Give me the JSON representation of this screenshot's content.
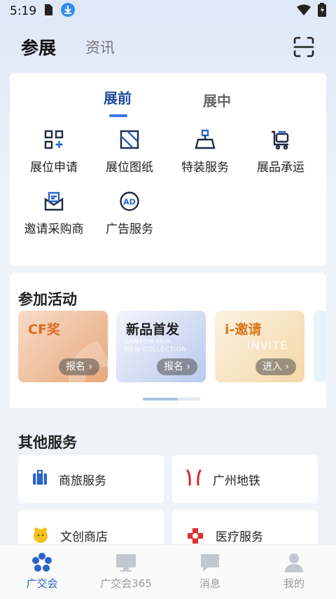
{
  "status_bar": {
    "time": "5:19"
  },
  "header": {
    "tabs": [
      "参展",
      "资讯"
    ]
  },
  "exhibit_card": {
    "subtabs": [
      "展前",
      "展中"
    ],
    "items": [
      {
        "label": "展位申请",
        "icon": "grid-plus-icon"
      },
      {
        "label": "展位图纸",
        "icon": "blueprint-icon"
      },
      {
        "label": "特装服务",
        "icon": "scale-icon"
      },
      {
        "label": "展品承运",
        "icon": "cart-icon"
      },
      {
        "label": "邀请采购商",
        "icon": "invite-mail-icon"
      },
      {
        "label": "广告服务",
        "icon": "ad-icon"
      }
    ]
  },
  "activities": {
    "title": "参加活动",
    "cards": [
      {
        "title": "CF奖",
        "button": "报名"
      },
      {
        "title": "新品首发",
        "button": "报名"
      },
      {
        "title": "i-邀请",
        "button": "进入"
      }
    ],
    "deco": {
      "new_collection": "CANTON FAIR\nNEW COLLECTION",
      "invite": "INVITE"
    }
  },
  "other_services": {
    "title": "其他服务",
    "items": [
      {
        "label": "商旅服务",
        "icon": "luggage-icon"
      },
      {
        "label": "广州地铁",
        "icon": "metro-icon"
      },
      {
        "label": "文创商店",
        "icon": "shop-mascot-icon"
      },
      {
        "label": "医疗服务",
        "icon": "medical-cross-icon"
      }
    ]
  },
  "bottom_nav": [
    {
      "label": "广交会",
      "active": true
    },
    {
      "label": "广交会365",
      "active": false
    },
    {
      "label": "消息",
      "active": false
    },
    {
      "label": "我的",
      "active": false
    }
  ],
  "colors": {
    "accent": "#2a63c9",
    "active_subtab": "#1d4a9c"
  }
}
